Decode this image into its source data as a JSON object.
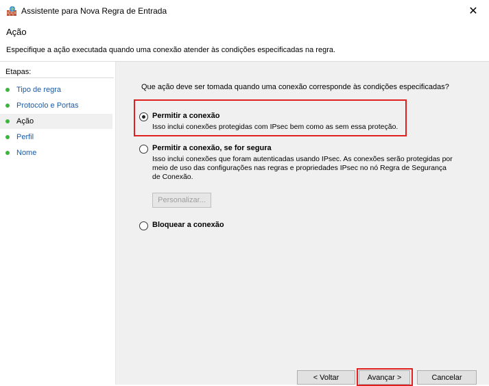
{
  "window": {
    "title": "Assistente para Nova Regra de Entrada",
    "close_glyph": "✕"
  },
  "header": {
    "title": "Ação",
    "description": "Especifique a ação executada quando uma conexão atender às condições especificadas na regra."
  },
  "sidebar": {
    "title": "Etapas:",
    "items": [
      {
        "label": "Tipo de regra",
        "current": false
      },
      {
        "label": "Protocolo e Portas",
        "current": false
      },
      {
        "label": "Ação",
        "current": true
      },
      {
        "label": "Perfil",
        "current": false
      },
      {
        "label": "Nome",
        "current": false
      }
    ]
  },
  "main": {
    "question": "Que ação deve ser tomada quando uma conexão corresponde às condições especificadas?",
    "options": [
      {
        "label": "Permitir a conexão",
        "description": "Isso inclui conexões protegidas com IPsec bem como as sem essa proteção.",
        "selected": true
      },
      {
        "label": "Permitir a conexão, se for segura",
        "description": "Isso inclui conexões que foram autenticadas usando IPsec. As conexões serão protegidas por meio de uso das configurações nas regras e propriedades IPsec no nó Regra de Segurança de Conexão.",
        "selected": false
      },
      {
        "label": "Bloquear a conexão",
        "description": "",
        "selected": false
      }
    ],
    "customize_button": "Personalizar..."
  },
  "footer": {
    "back_button": "< Voltar",
    "next_button": "Avançar >",
    "cancel_button": "Cancelar"
  },
  "colors": {
    "highlight": "#e02020",
    "step_dot": "#3fb33f",
    "link": "#1a5aa5",
    "content_bg": "#f0f0f0"
  },
  "icons": {
    "app": "firewall-icon",
    "close": "close-icon"
  }
}
